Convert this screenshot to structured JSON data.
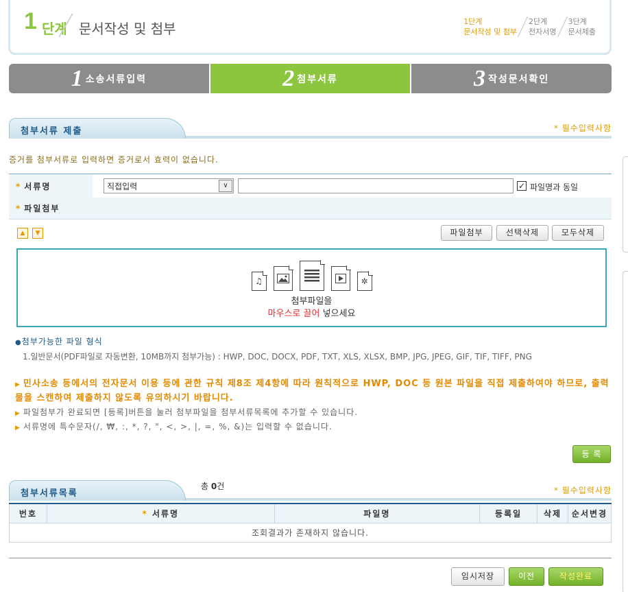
{
  "header": {
    "step_num": "1",
    "step_word": "단계",
    "title": "문서작성 및 첨부",
    "mini_steps": [
      {
        "line1": "1단계",
        "line2": "문서작성 및 첨부"
      },
      {
        "line1": "2단계",
        "line2": "전자서명"
      },
      {
        "line1": "3단계",
        "line2": "문서제출"
      }
    ]
  },
  "tabs": [
    {
      "num": "1",
      "label": "소송서류입력"
    },
    {
      "num": "2",
      "label": "첨부서류"
    },
    {
      "num": "3",
      "label": "작성문서확인"
    }
  ],
  "submit_section": {
    "title": "첨부서류 제출",
    "required_note": "* 필수입력사항",
    "warning": "증거를 첨부서류로 입력하면 증거로서 효력이 없습니다.",
    "doc_name_label": "서류명",
    "select_value": "직접입력",
    "select_arrow": "∨",
    "text_value": "",
    "checkbox_mark": "✓",
    "same_as_file_label": "파일명과 동일",
    "file_attach_label": "파일첨부",
    "up_arrow": "▲",
    "down_arrow": "▼",
    "btn_attach": "파일첨부",
    "btn_delete_selected": "선택삭제",
    "btn_delete_all": "모두삭제",
    "drop_line1": "첨부파일을",
    "drop_line2_red": "마우스로 끌어",
    "drop_line2_rest": " 넣으세요",
    "file_icons": [
      "music-file-icon",
      "image-file-icon",
      "document-file-icon",
      "video-file-icon",
      "settings-file-icon"
    ],
    "format_title": "첨부가능한 파일 형식",
    "format_desc": "1.일반문서(PDF파일로 자동변환, 10MB까지 첨부가능) : HWP, DOC, DOCX, PDF, TXT, XLS, XLSX, BMP, JPG, JPEG, GIF, TIF, TIFF, PNG",
    "notice_orange": "민사소송 등에서의 전자문서 이용 등에 관한 규칙 제8조 제4항에 따라 원칙적으로 HWP, DOC 등 원본 파일을 직접 제출하여야 하므로, 출력물을 스캔하여 제출하지 않도록 유의하시기 바랍니다.",
    "notice_1": "파일첨부가 완료되면 [등록]버튼을 눌러 첨부파일을 첨부서류목록에 추가할 수 있습니다.",
    "notice_2": "서류명에 특수문자(/, ₩, :, *, ?, \", <, >, |, =, %, &)는 입력할 수 없습니다.",
    "btn_register": "등 록"
  },
  "list_section": {
    "title": "첨부서류목록",
    "total_prefix": "총 ",
    "total_count": "0",
    "total_suffix": "건",
    "required_note": "* 필수입력사항",
    "columns": [
      "번호",
      "서류명",
      "파일명",
      "등록일",
      "삭제",
      "순서변경"
    ],
    "empty_message": "조회결과가 존재하지 않습니다."
  },
  "footer": {
    "btn_temp_save": "임시저장",
    "btn_prev": "이전",
    "btn_complete": "작성완료"
  },
  "colors": {
    "accent_green": "#8cc63f",
    "accent_orange": "#e39a00",
    "navy": "#1e5a8a"
  }
}
